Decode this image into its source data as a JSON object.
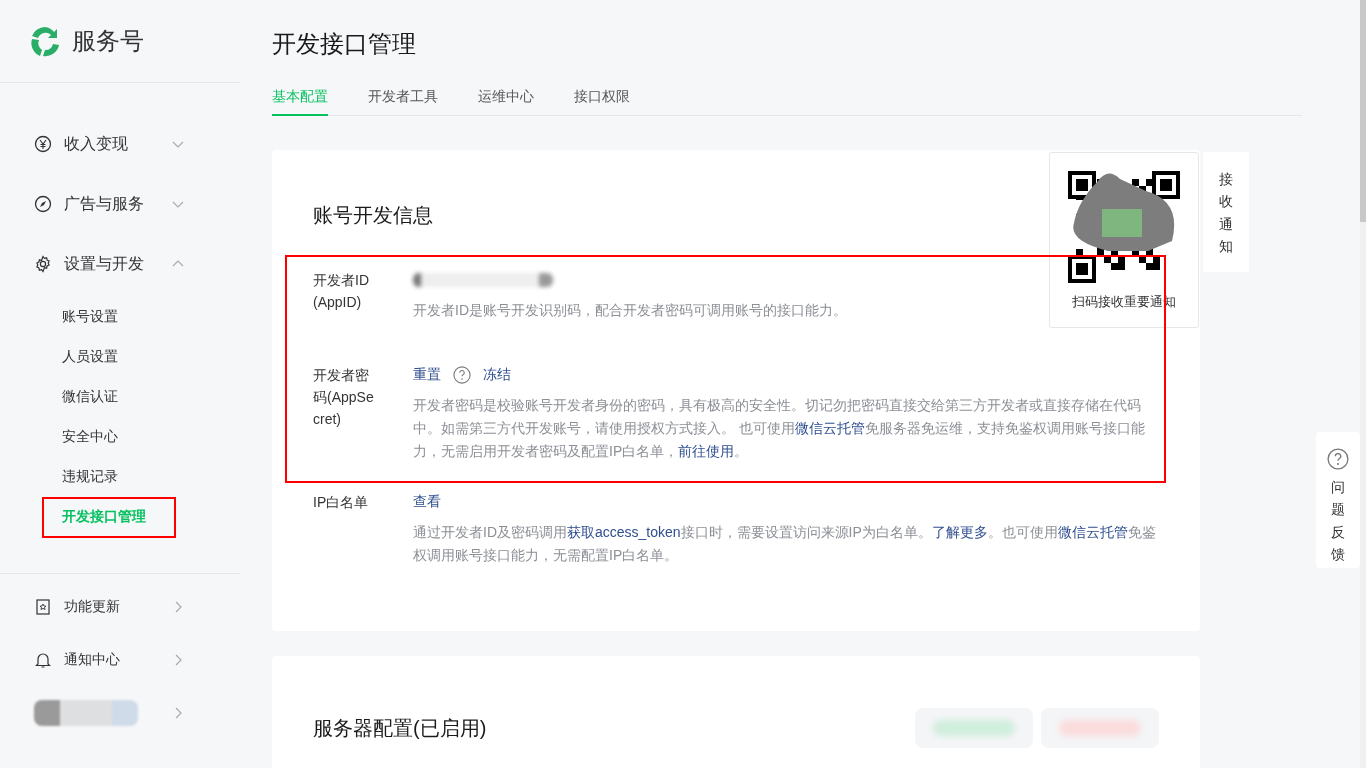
{
  "sidebar": {
    "logo": "服务号",
    "menu": [
      {
        "label": "收入变现",
        "kind": "yen",
        "expanded": false
      },
      {
        "label": "广告与服务",
        "kind": "compass",
        "expanded": false
      },
      {
        "label": "设置与开发",
        "kind": "gear",
        "expanded": true
      }
    ],
    "submenu": [
      {
        "label": "账号设置",
        "selected": false,
        "highlighted": false
      },
      {
        "label": "人员设置",
        "selected": false,
        "highlighted": false
      },
      {
        "label": "微信认证",
        "selected": false,
        "highlighted": false
      },
      {
        "label": "安全中心",
        "selected": false,
        "highlighted": false
      },
      {
        "label": "违规记录",
        "selected": false,
        "highlighted": false
      },
      {
        "label": "开发接口管理",
        "selected": true,
        "highlighted": true
      }
    ],
    "footer": [
      {
        "label": "功能更新",
        "kind": "book"
      },
      {
        "label": "通知中心",
        "kind": "bell"
      }
    ]
  },
  "page": {
    "title": "开发接口管理",
    "tabs": [
      {
        "label": "基本配置",
        "selected": true
      },
      {
        "label": "开发者工具",
        "selected": false
      },
      {
        "label": "运维中心",
        "selected": false
      },
      {
        "label": "接口权限",
        "selected": false
      }
    ]
  },
  "account_card": {
    "title": "账号开发信息",
    "fields": [
      {
        "label": "开发者ID(AppID)",
        "highlighted": true,
        "value_redacted": true,
        "description": [
          {
            "text": "开发者ID是账号开发识别码，配合开发者密码可调用账号的接口能力。"
          }
        ]
      },
      {
        "label": "开发者密码(AppSecret)",
        "highlighted": true,
        "actions": [
          {
            "text": "重置",
            "kind": "link"
          },
          {
            "kind": "help"
          },
          {
            "text": "冻结",
            "kind": "link"
          }
        ],
        "description": [
          {
            "text": "开发者密码是校验账号开发者身份的密码，具有极高的安全性。切记勿把密码直接交给第三方开发者或直接存储在代码中。如需第三方代开发账号，请使用授权方式接入。 也可使用"
          },
          {
            "link": "微信云托管"
          },
          {
            "text": "免服务器免运维，支持免鉴权调用账号接口能力，无需启用开发者密码及配置IP白名单，"
          },
          {
            "link": "前往使用"
          },
          {
            "text": "。"
          }
        ]
      },
      {
        "label": "IP白名单",
        "highlighted": false,
        "actions": [
          {
            "text": "查看",
            "kind": "link"
          }
        ],
        "description": [
          {
            "text": "通过开发者ID及密码调用"
          },
          {
            "link": "获取access_token"
          },
          {
            "text": "接口时，需要设置访问来源IP为白名单。"
          },
          {
            "link": "了解更多"
          },
          {
            "text": "。也可使用"
          },
          {
            "link": "微信云托管"
          },
          {
            "text": "免鉴权调用账号接口能力，无需配置IP白名单。"
          }
        ]
      }
    ]
  },
  "server_card": {
    "title": "服务器配置(已启用)"
  },
  "qr_popup": {
    "caption": "扫码接收重要通知"
  },
  "notify_tab": {
    "label": "接收通知"
  },
  "feedback": {
    "label": "问题反馈"
  }
}
